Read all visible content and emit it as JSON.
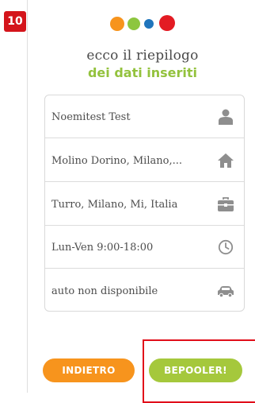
{
  "step": {
    "number": "10"
  },
  "logo": {
    "colors": [
      "#f7941d",
      "#8dc63f",
      "#1f75bc",
      "#e31b23"
    ]
  },
  "header": {
    "title": "ecco il riepilogo",
    "subtitle": "dei dati inseriti"
  },
  "summary": {
    "rows": [
      {
        "label": "Noemitest  Test",
        "icon": "user-icon"
      },
      {
        "label": "Molino Dorino, Milano,...",
        "icon": "home-icon"
      },
      {
        "label": "Turro, Milano, Mi, Italia",
        "icon": "briefcase-icon"
      },
      {
        "label": "Lun-Ven 9:00-18:00",
        "icon": "clock-icon"
      },
      {
        "label": "auto non disponibile",
        "icon": "car-icon"
      }
    ]
  },
  "buttons": {
    "back_label": "INDIETRO",
    "next_label": "BEPOOLER!"
  },
  "colors": {
    "accent_green": "#93c23d",
    "button_orange": "#f7941d",
    "button_green": "#a5c83c",
    "highlight_red": "#e10e1a"
  }
}
